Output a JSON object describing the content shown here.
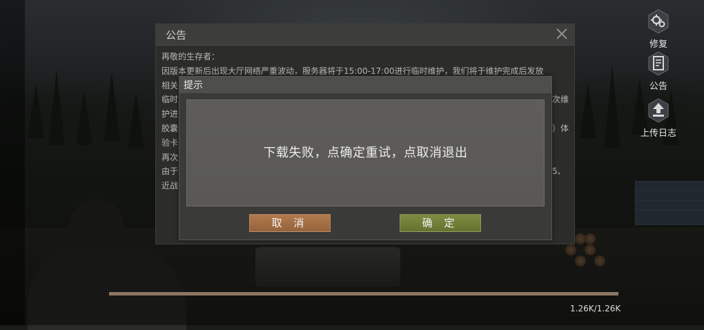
{
  "side_buttons": {
    "repair_label": "修复",
    "notice_label": "公告",
    "upload_log_label": "上传日志"
  },
  "notice": {
    "title": "公告",
    "lines": [
      "再敬的生存者：",
      "因版本更新后出现大厅网络严重波动，服务器将于15:00-17:00进行临时维护，我们将于维护完成后发放",
      "相关",
      "临时",
      "护进",
      "胶囊",
      "验卡",
      "再次",
      "",
      "由于",
      "近战"
    ],
    "fragments": {
      "line4_right": "次维",
      "line6_right": "）体",
      "line10_right": "5、"
    }
  },
  "dialog": {
    "title": "提示",
    "message": "下载失败，点确定重试，点取消退出",
    "cancel_label": "取 消",
    "ok_label": "确 定"
  },
  "progress": {
    "text": "1.26K/1.26K",
    "fraction": 1.0
  },
  "colors": {
    "cancel_button": "#a86f45",
    "ok_button": "#737f38",
    "progress_fill": "#8d7763"
  }
}
